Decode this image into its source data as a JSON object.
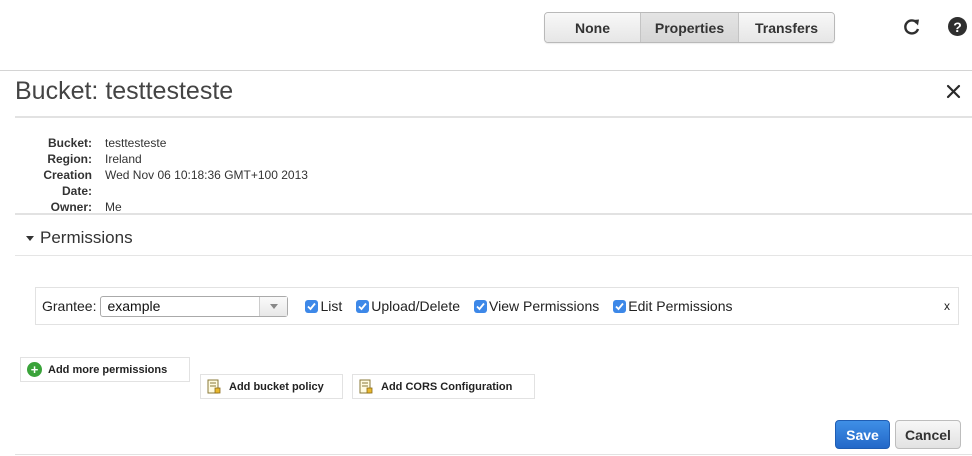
{
  "toolbar": {
    "views": [
      {
        "label": "None",
        "active": false
      },
      {
        "label": "Properties",
        "active": true
      },
      {
        "label": "Transfers",
        "active": false
      }
    ],
    "refresh_icon": "refresh-icon",
    "help_label": "?"
  },
  "panel": {
    "title": "Bucket: testtesteste",
    "close_icon": "close-icon"
  },
  "info": {
    "bucket_label": "Bucket:",
    "bucket_value": "testtesteste",
    "region_label": "Region:",
    "region_value": "Ireland",
    "creation_label": "Creation Date:",
    "creation_value": "Wed Nov 06 10:18:36 GMT+100 2013",
    "owner_label": "Owner:",
    "owner_value": "Me"
  },
  "permissions": {
    "header": "Permissions",
    "grantee_label": "Grantee:",
    "grantee_value": "example",
    "checks": [
      {
        "label": "List",
        "checked": true
      },
      {
        "label": "Upload/Delete",
        "checked": true
      },
      {
        "label": "View Permissions",
        "checked": true
      },
      {
        "label": "Edit Permissions",
        "checked": true
      }
    ],
    "remove_label": "x",
    "add_more_label": "Add more permissions",
    "bucket_policy_label": "Add bucket policy",
    "cors_label": "Add CORS Configuration"
  },
  "actions": {
    "save_label": "Save",
    "cancel_label": "Cancel"
  },
  "colors": {
    "accent": "#2a74d4",
    "checkbox": "#3d88e8",
    "add_icon": "#3aa33a"
  }
}
